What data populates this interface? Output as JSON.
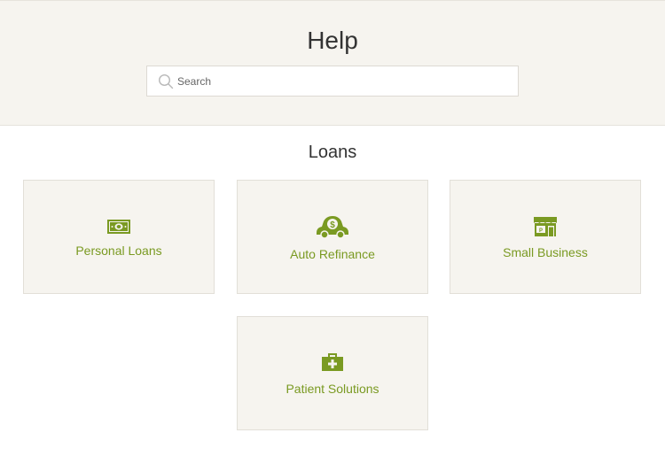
{
  "header": {
    "title": "Help",
    "search_placeholder": "Search"
  },
  "section": {
    "title": "Loans"
  },
  "cards": [
    {
      "label": "Personal Loans",
      "icon": "money-bill-icon"
    },
    {
      "label": "Auto Refinance",
      "icon": "car-dollar-icon"
    },
    {
      "label": "Small Business",
      "icon": "storefront-icon"
    },
    {
      "label": "Patient Solutions",
      "icon": "medical-kit-icon"
    }
  ],
  "colors": {
    "accent": "#7a9a22",
    "panel": "#f6f4ef"
  }
}
